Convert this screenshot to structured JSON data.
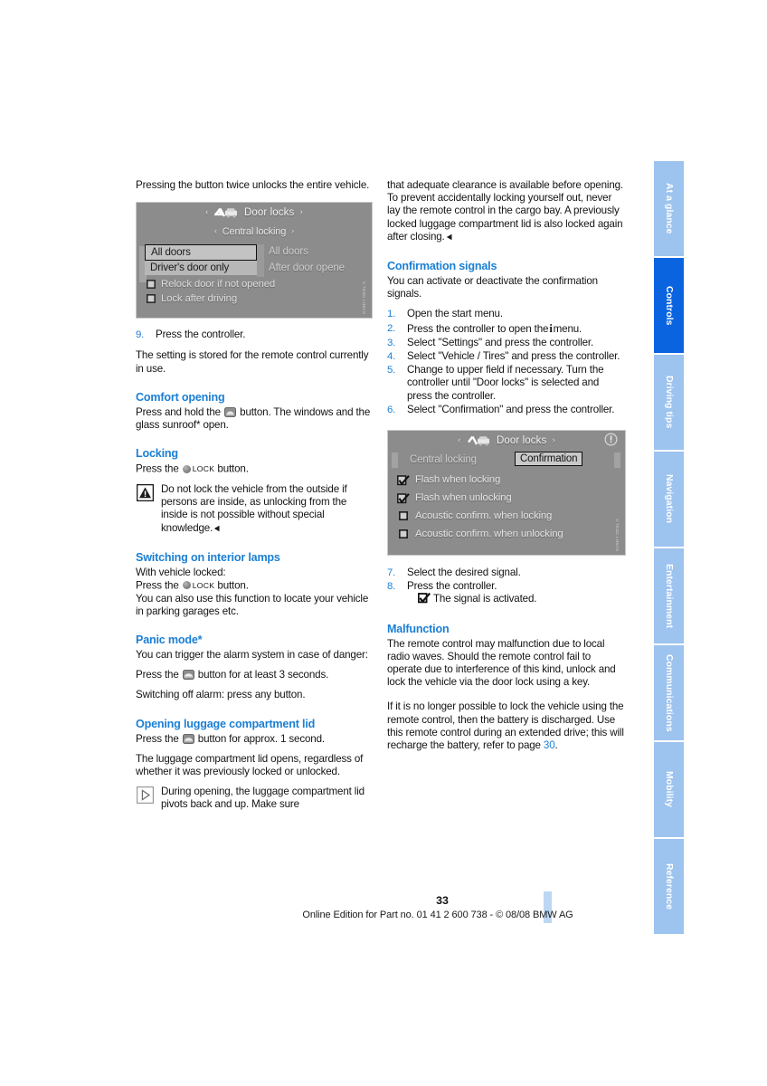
{
  "page": {
    "number": "33",
    "footer_note": "Online Edition for Part no. 01 41 2 600 738 - © 08/08 BMW AG"
  },
  "nav_tabs": [
    {
      "label": "At a glance",
      "active": false
    },
    {
      "label": "Controls",
      "active": true
    },
    {
      "label": "Driving tips",
      "active": false
    },
    {
      "label": "Navigation",
      "active": false
    },
    {
      "label": "Entertainment",
      "active": false
    },
    {
      "label": "Communications",
      "active": false
    },
    {
      "label": "Mobility",
      "active": false
    },
    {
      "label": "Reference",
      "active": false
    }
  ],
  "colors": {
    "heading_blue": "#1b7fd4",
    "tab_blue": "#9dc3ef",
    "tab_active_blue": "#0a64e0",
    "edge_bar_blue": "#bcd7f4",
    "idrive_grey": "#8c8c8c"
  },
  "left_column": {
    "intro": "Pressing the button twice unlocks the entire vehicle.",
    "figure1": {
      "title": "Door locks",
      "subtitle": "Central locking",
      "nav_arrow_left": "‹",
      "nav_arrow_right": "›",
      "selected_option": "All doors",
      "secondary_option": "Driver's door only",
      "right_col_option1": "All doors",
      "right_col_option2": "After door opene",
      "checkbox_rows": [
        {
          "label": "Relock door if not opened",
          "checked": false
        },
        {
          "label": "Lock after driving",
          "checked": false
        }
      ],
      "credit": "V.TE3D.LH6AS"
    },
    "step9": {
      "num": "9.",
      "text": "Press the controller."
    },
    "step9_after": "The setting is stored for the remote control currently in use.",
    "comfort_opening": {
      "heading": "Comfort opening",
      "body_before": "Press and hold the",
      "body_after": "button. The windows and the glass sunroof* open."
    },
    "locking": {
      "heading": "Locking",
      "press_text": "Press the",
      "lock_word": "LOCK",
      "press_text_after": "button.",
      "warning": "Do not lock the vehicle from the outside if persons are inside, as unlocking from the inside is not possible without special knowledge."
    },
    "interior_lamps": {
      "heading": "Switching on interior lamps",
      "line1": "With vehicle locked:",
      "press_text": "Press the",
      "lock_word": "LOCK",
      "press_text_after": "button.",
      "line3": "You can also use this function to locate your vehicle in parking garages etc."
    },
    "panic_mode": {
      "heading": "Panic mode*",
      "line1": "You can trigger the alarm system in case of danger:",
      "press_before": "Press the",
      "press_after": "button for at least 3 seconds.",
      "line3": "Switching off alarm: press any button."
    },
    "luggage": {
      "heading": "Opening luggage compartment lid",
      "press_before": "Press the",
      "press_after": "button for approx. 1 second.",
      "line2": "The luggage compartment lid opens, regardless of whether it was previously locked or unlocked.",
      "note": "During opening, the luggage compartment lid pivots back and up. Make sure"
    }
  },
  "right_column": {
    "continuation": "that adequate clearance is available before opening.",
    "continuation2": "To prevent accidentally locking yourself out, never lay the remote control in the cargo bay. A previously locked luggage compartment lid is also locked again after closing.",
    "confirmation_signals": {
      "heading": "Confirmation signals",
      "intro": "You can activate or deactivate the confirmation signals.",
      "steps": [
        {
          "num": "1.",
          "text": "Open the start menu."
        },
        {
          "num": "2.",
          "text_before": "Press the controller to open the",
          "text_after": "menu."
        },
        {
          "num": "3.",
          "text": "Select \"Settings\" and press the controller."
        },
        {
          "num": "4.",
          "text": "Select \"Vehicle / Tires\" and press the controller."
        },
        {
          "num": "5.",
          "text": "Change to upper field if necessary. Turn the controller until \"Door locks\" is selected and press the controller."
        },
        {
          "num": "6.",
          "text": "Select \"Confirmation\" and press the controller."
        }
      ]
    },
    "figure2": {
      "title": "Door locks",
      "nav_arrow_left": "‹",
      "nav_arrow_right": "›",
      "tab_inactive": "Central locking",
      "tab_active": "Confirmation",
      "checkbox_rows": [
        {
          "label": "Flash when locking",
          "checked": true
        },
        {
          "label": "Flash when unlocking",
          "checked": true
        },
        {
          "label": "Acoustic confirm. when locking",
          "checked": false
        },
        {
          "label": "Acoustic confirm. when unlocking",
          "checked": false
        }
      ],
      "credit": "V.TE3D.LH6AS"
    },
    "steps_after": [
      {
        "num": "7.",
        "text": "Select the desired signal."
      },
      {
        "num": "8.",
        "text": "Press the controller."
      }
    ],
    "signal_activated": "The signal is activated.",
    "malfunction": {
      "heading": "Malfunction",
      "para1": "The remote control may malfunction due to local radio waves. Should the remote control fail to operate due to interference of this kind, unlock and lock the vehicle via the door lock using a key.",
      "para2_before": "If it is no longer possible to lock the vehicle using the remote control, then the battery is discharged. Use this remote control during an extended drive; this will recharge the battery, refer to page",
      "page_link": "30",
      "para2_after": "."
    }
  }
}
